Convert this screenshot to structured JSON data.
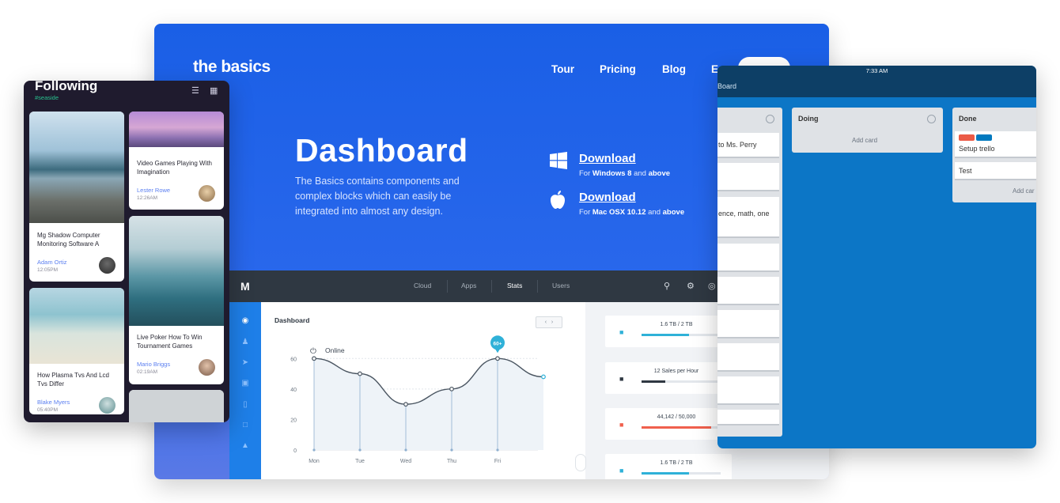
{
  "hero": {
    "logo": "the basics",
    "nav": [
      "Tour",
      "Pricing",
      "Blog",
      "E"
    ],
    "title": "Dashboard",
    "description": "The Basics contains components and complex blocks which can easily be integrated into almost any design.",
    "downloads": [
      {
        "icon": "windows-icon",
        "label": "Download",
        "sub_prefix": "For",
        "sub_os": "Windows 8",
        "sub_mid": "and",
        "sub_suffix": "above"
      },
      {
        "icon": "apple-icon",
        "label": "Download",
        "sub_prefix": "For",
        "sub_os": "Mac OSX 10.12",
        "sub_mid": "and",
        "sub_suffix": "above"
      }
    ]
  },
  "admin": {
    "logo": "M",
    "tabs": [
      "Cloud",
      "Apps",
      "Stats",
      "Users"
    ],
    "active_tab": "Stats",
    "panel_title": "Dashboard",
    "online_label": "Online",
    "stats": [
      {
        "label": "1.6 TB / 2 TB",
        "fraction": 0.6,
        "color": "#2fb1d8",
        "icon": "database-icon"
      },
      {
        "label": "12 Sales per Hour",
        "fraction": 0.3,
        "color": "#2f3842",
        "icon": "tag-icon"
      },
      {
        "label": "44,142 / 50,000",
        "fraction": 0.88,
        "color": "#f0604d",
        "icon": "users-icon"
      },
      {
        "label": "1.6 TB / 2 TB",
        "fraction": 0.6,
        "color": "#2fb1d8",
        "icon": "database-icon"
      }
    ]
  },
  "chart_data": {
    "type": "line",
    "categories": [
      "Mon",
      "Tue",
      "Wed",
      "Thu",
      "Fri"
    ],
    "series": [
      {
        "values": [
          60,
          50,
          30,
          40,
          60,
          48
        ]
      }
    ],
    "y_ticks": [
      0,
      20,
      40,
      60
    ],
    "ylim": [
      0,
      70
    ],
    "callout": "60+",
    "grid": true
  },
  "phone": {
    "title": "Following",
    "tag": "#seaside",
    "cards": [
      {
        "title": "Mg Shadow Computer Monitoring Software A",
        "author": "Adam Ortiz",
        "time": "12:05PM"
      },
      {
        "title": "Video Games Playing With Imagination",
        "author": "Lester Rowe",
        "time": "12:26AM"
      },
      {
        "title": "How Plasma Tvs And Lcd Tvs Differ",
        "author": "Blake Myers",
        "time": "05:40PM"
      },
      {
        "title": "Live Poker How To Win Tournament Games",
        "author": "Mario Briggs",
        "time": "02:19AM"
      }
    ]
  },
  "trello": {
    "time": "7:33 AM",
    "board": "Board",
    "col1_snippets": [
      "to Ms. Perry",
      "ence, math, one"
    ],
    "doing": {
      "title": "Doing",
      "add": "Add card"
    },
    "done": {
      "title": "Done",
      "cards": [
        "Setup trello",
        "Test"
      ],
      "add": "Add car"
    },
    "label_colors": [
      "#eb5a46",
      "#0079bf"
    ]
  }
}
